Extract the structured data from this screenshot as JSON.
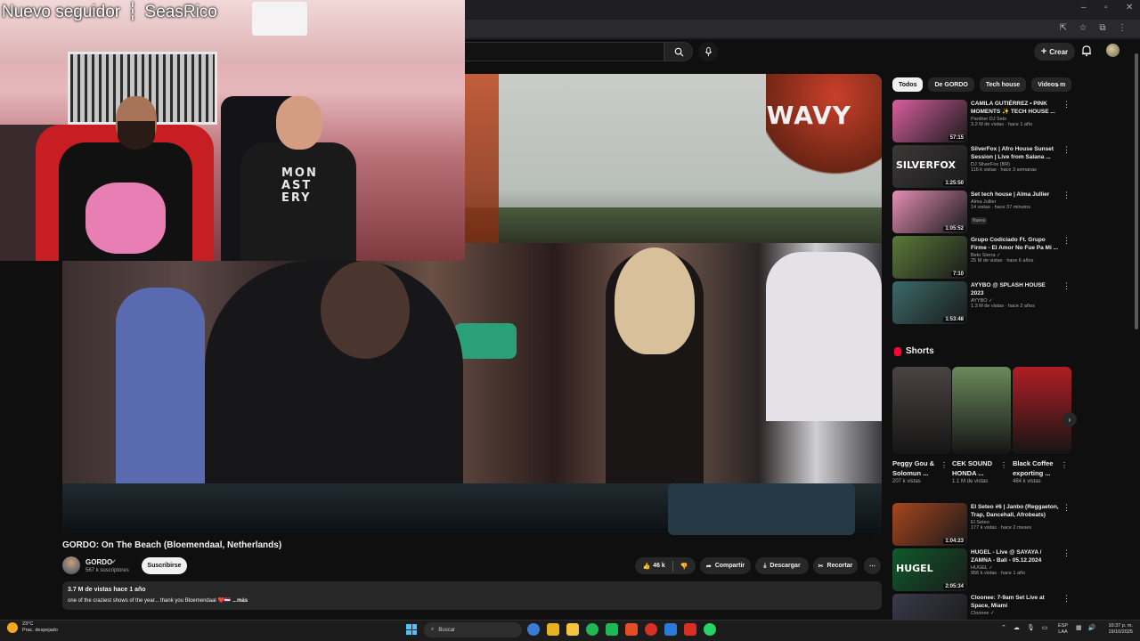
{
  "overlay": {
    "follower_label": "Nuevo seguidor",
    "separator": "┆",
    "follower_name": "SeasRico",
    "shirt_text": "MON AST ERY"
  },
  "header": {
    "create_label": "Crear"
  },
  "video": {
    "logo_text": "WAVY",
    "title": "GORDO: On The Beach (Bloemendaal, Netherlands)",
    "channel_name": "GORDO",
    "subscribers": "567 k suscriptores",
    "subscribe_label": "Suscribirse",
    "likes": "46 k",
    "share_label": "Compartir",
    "download_label": "Descargar",
    "clip_label": "Recortar",
    "views_date": "3.7 M de vistas  hace 1 año",
    "description": "one of the craziest shows of the year... thank you Bloemendaal ",
    "description_emojis": "❤️🇳🇱",
    "more_label": "...más"
  },
  "chips": [
    {
      "label": "Todos",
      "active": true
    },
    {
      "label": "De GORDO",
      "active": false
    },
    {
      "label": "Tech house",
      "active": false
    },
    {
      "label": "Videos m",
      "active": false
    }
  ],
  "recommendations": [
    {
      "title": "CAMILA GUTIÉRREZ • PINK MOMENTS ✨ TECH HOUSE ...",
      "channel": "Panther DJ Sets",
      "views": "3.2 M de vistas · hace 1 año",
      "duration": "57:15",
      "thumb_color": "#d95fa0"
    },
    {
      "title": "SilverFox | Afro House Sunset Session | Live from Salana ...",
      "channel": "DJ SilverFox (BR)",
      "views": "116 k vistas · hace 3 semanas",
      "duration": "1:25:50",
      "thumb_color": "#3b3838",
      "thumb_text": "SILVERFOX"
    },
    {
      "title": "Set tech house | Alma Jullier",
      "channel": "Alma Jullier",
      "views": "14 vistas · hace 37 minutos",
      "duration": "1:05:52",
      "thumb_color": "#e58fb4",
      "badge": "Nuevo"
    },
    {
      "title": "Grupo Codiciado Ft. Grupo Firme - El Amor No Fue Pa Mi ...",
      "channel": "Beto Sierra ✓",
      "views": "25 M de vistas · hace 6 años",
      "duration": "7:10",
      "thumb_color": "#5a7a3a"
    },
    {
      "title": "AYYBO @ SPLASH HOUSE 2023",
      "channel": "AYYBO ✓",
      "views": "1.3 M de vistas · hace 2 años",
      "duration": "1:53:48",
      "thumb_color": "#3c6a6a"
    },
    {
      "title": "El Seteo #6 | Janbo (Reggaeton, Trap, Dancehall, Afrobeats)",
      "channel": "El Seteo",
      "views": "177 k vistas · hace 2 meses",
      "duration": "1:04:23",
      "thumb_color": "#a8461e"
    },
    {
      "title": "HUGEL - Live @ SAYAYA / ZAMNA - Bali - 05.12.2024",
      "channel": "HUGEL ✓",
      "views": "956 k vistas · hace 1 año",
      "duration": "2:05:34",
      "thumb_color": "#0f5a2a",
      "thumb_text": "HUGEL"
    },
    {
      "title": "Cloonee: 7-9am Set Live at Space, Miami",
      "channel": "Cloonee ✓",
      "views": "",
      "duration": "",
      "thumb_color": "#3a3a4a"
    }
  ],
  "shorts": {
    "heading": "Shorts",
    "items": [
      {
        "title": "Peggy Gou & Solomun ...",
        "views": "207 k vistas",
        "thumb_color": "#4a4442"
      },
      {
        "title": "CEK SOUND HONDA ...",
        "views": "1.1 M de vistas",
        "thumb_color": "#6a8a5a"
      },
      {
        "title": "Black Coffee exporting ...",
        "views": "484 k vistas",
        "thumb_color": "#b01e24"
      }
    ]
  },
  "taskbar": {
    "temperature": "23°C",
    "weather": "Prac. despejado",
    "search_placeholder": "Buscar",
    "lang_top": "ESP",
    "lang_bottom": "LAA",
    "time": "10:37 p. m.",
    "date": "19/10/2025",
    "app_colors": [
      "#3a7bd5",
      "#e8b21e",
      "#f5c542",
      "#1db954",
      "#1db954",
      "#e44d26",
      "#d93025",
      "#2b7bd8",
      "#d93025",
      "#25d366"
    ]
  }
}
